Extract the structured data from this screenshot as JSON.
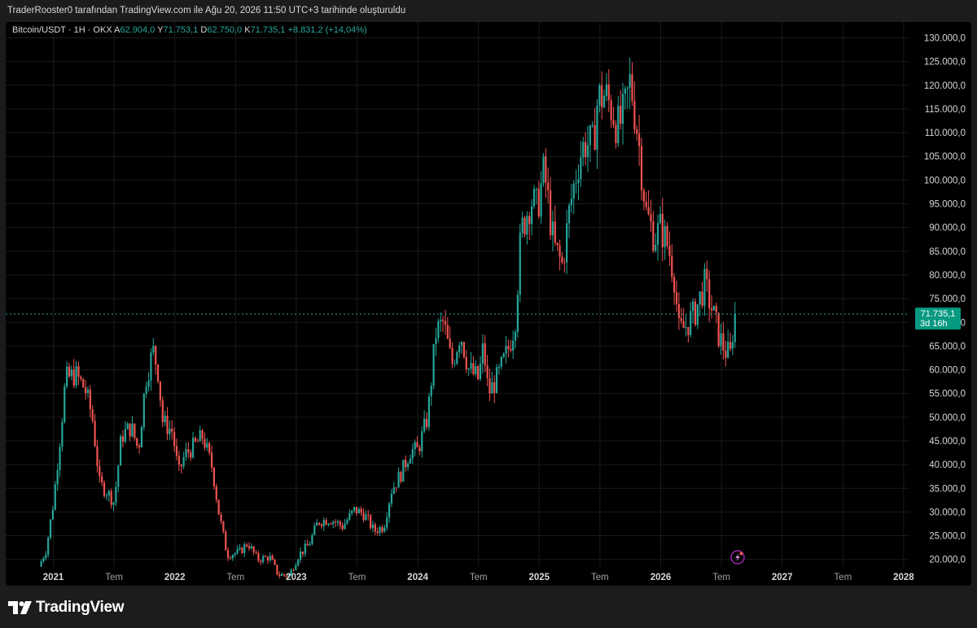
{
  "header": {
    "attribution": "TraderRooster0 tarafından TradingView.com ile Ağu 20, 2026 11:50 UTC+3 tarihinde oluşturuldu"
  },
  "legend": {
    "symbol": "Bitcoin/USDT · 1H · OKX",
    "a_label": "A",
    "a_value": "62.904,0",
    "y_label": "Y",
    "y_value": "71.753,1",
    "d_label": "D",
    "d_value": "62.750,0",
    "k_label": "K",
    "k_value": "71.735,1",
    "change": "+8.831,2 (+14,04%)"
  },
  "price_badge": {
    "price": "71.735,1",
    "countdown": "3d 16h"
  },
  "footer": {
    "brand": "TradingView"
  },
  "colors": {
    "up": "#26a69a",
    "down": "#ef5350",
    "background": "#000000",
    "text": "#d8d8d8"
  },
  "chart_data": {
    "type": "candlestick",
    "title": "Bitcoin/USDT · 1H · OKX",
    "ylim": [
      18000,
      131000
    ],
    "y_ticks": [
      20000,
      25000,
      30000,
      35000,
      40000,
      45000,
      50000,
      55000,
      60000,
      65000,
      70000,
      75000,
      80000,
      85000,
      90000,
      95000,
      100000,
      105000,
      110000,
      115000,
      120000,
      125000,
      130000
    ],
    "y_tick_labels": [
      "20.000,0",
      "25.000,0",
      "30.000,0",
      "35.000,0",
      "40.000,0",
      "45.000,0",
      "50.000,0",
      "55.000,0",
      "60.000,0",
      "65.000,0",
      "70.000,0",
      "75.000,0",
      "80.000,0",
      "85.000,0",
      "90.000,0",
      "95.000,0",
      "100.000,0",
      "105.000,0",
      "110.000,0",
      "115.000,0",
      "120.000,0",
      "125.000,0",
      "130.000,0"
    ],
    "x_ticks": [
      {
        "t": 2021.0,
        "label": "2021",
        "major": true
      },
      {
        "t": 2021.5,
        "label": "Tem",
        "major": false
      },
      {
        "t": 2022.0,
        "label": "2022",
        "major": true
      },
      {
        "t": 2022.5,
        "label": "Tem",
        "major": false
      },
      {
        "t": 2023.0,
        "label": "2023",
        "major": true
      },
      {
        "t": 2023.5,
        "label": "Tem",
        "major": false
      },
      {
        "t": 2024.0,
        "label": "2024",
        "major": true
      },
      {
        "t": 2024.5,
        "label": "Tem",
        "major": false
      },
      {
        "t": 2025.0,
        "label": "2025",
        "major": true
      },
      {
        "t": 2025.5,
        "label": "Tem",
        "major": false
      },
      {
        "t": 2026.0,
        "label": "2026",
        "major": true
      },
      {
        "t": 2026.5,
        "label": "Tem",
        "major": false
      },
      {
        "t": 2027.0,
        "label": "2027",
        "major": true
      },
      {
        "t": 2027.5,
        "label": "Tem",
        "major": false
      },
      {
        "t": 2028.0,
        "label": "2028",
        "major": true
      }
    ],
    "last_price": 71735.1,
    "price_path": [
      [
        2020.9,
        18500
      ],
      [
        2020.96,
        22000
      ],
      [
        2021.02,
        32000
      ],
      [
        2021.08,
        47000
      ],
      [
        2021.12,
        58000
      ],
      [
        2021.2,
        59000
      ],
      [
        2021.28,
        56000
      ],
      [
        2021.34,
        50000
      ],
      [
        2021.4,
        36000
      ],
      [
        2021.47,
        34000
      ],
      [
        2021.52,
        32000
      ],
      [
        2021.58,
        46000
      ],
      [
        2021.66,
        48000
      ],
      [
        2021.72,
        43000
      ],
      [
        2021.78,
        58000
      ],
      [
        2021.84,
        64000
      ],
      [
        2021.88,
        60000
      ],
      [
        2021.92,
        49000
      ],
      [
        2022.0,
        47000
      ],
      [
        2022.05,
        38000
      ],
      [
        2022.1,
        42000
      ],
      [
        2022.18,
        44000
      ],
      [
        2022.25,
        46000
      ],
      [
        2022.33,
        39000
      ],
      [
        2022.38,
        30000
      ],
      [
        2022.45,
        21000
      ],
      [
        2022.55,
        21500
      ],
      [
        2022.62,
        23500
      ],
      [
        2022.7,
        20000
      ],
      [
        2022.8,
        20500
      ],
      [
        2022.87,
        16800
      ],
      [
        2022.96,
        16600
      ],
      [
        2023.04,
        21000
      ],
      [
        2023.12,
        23000
      ],
      [
        2023.2,
        28000
      ],
      [
        2023.3,
        28500
      ],
      [
        2023.4,
        27000
      ],
      [
        2023.5,
        30500
      ],
      [
        2023.58,
        29500
      ],
      [
        2023.66,
        26000
      ],
      [
        2023.74,
        27000
      ],
      [
        2023.8,
        34500
      ],
      [
        2023.88,
        38000
      ],
      [
        2023.96,
        43000
      ],
      [
        2024.02,
        43000
      ],
      [
        2024.1,
        50000
      ],
      [
        2024.17,
        68000
      ],
      [
        2024.23,
        70000
      ],
      [
        2024.3,
        61000
      ],
      [
        2024.37,
        68000
      ],
      [
        2024.44,
        60000
      ],
      [
        2024.52,
        58000
      ],
      [
        2024.56,
        65000
      ],
      [
        2024.6,
        55000
      ],
      [
        2024.68,
        58500
      ],
      [
        2024.76,
        64000
      ],
      [
        2024.82,
        70000
      ],
      [
        2024.87,
        89000
      ],
      [
        2024.95,
        96000
      ],
      [
        2025.0,
        94000
      ],
      [
        2025.06,
        102000
      ],
      [
        2025.14,
        86000
      ],
      [
        2025.21,
        82000
      ],
      [
        2025.27,
        94000
      ],
      [
        2025.35,
        105000
      ],
      [
        2025.4,
        108000
      ],
      [
        2025.46,
        107000
      ],
      [
        2025.5,
        117000
      ],
      [
        2025.56,
        118000
      ],
      [
        2025.62,
        115000
      ],
      [
        2025.67,
        111000
      ],
      [
        2025.72,
        114000
      ],
      [
        2025.77,
        121000
      ],
      [
        2025.83,
        110000
      ],
      [
        2025.9,
        93000
      ],
      [
        2025.97,
        88000
      ],
      [
        2026.02,
        90000
      ],
      [
        2026.08,
        86000
      ],
      [
        2026.13,
        80000
      ],
      [
        2026.17,
        68000
      ],
      [
        2026.22,
        69000
      ],
      [
        2026.3,
        72000
      ],
      [
        2026.38,
        78000
      ],
      [
        2026.45,
        72000
      ],
      [
        2026.5,
        67000
      ],
      [
        2026.55,
        64000
      ],
      [
        2026.6,
        62900
      ],
      [
        2026.62,
        71735
      ]
    ]
  }
}
